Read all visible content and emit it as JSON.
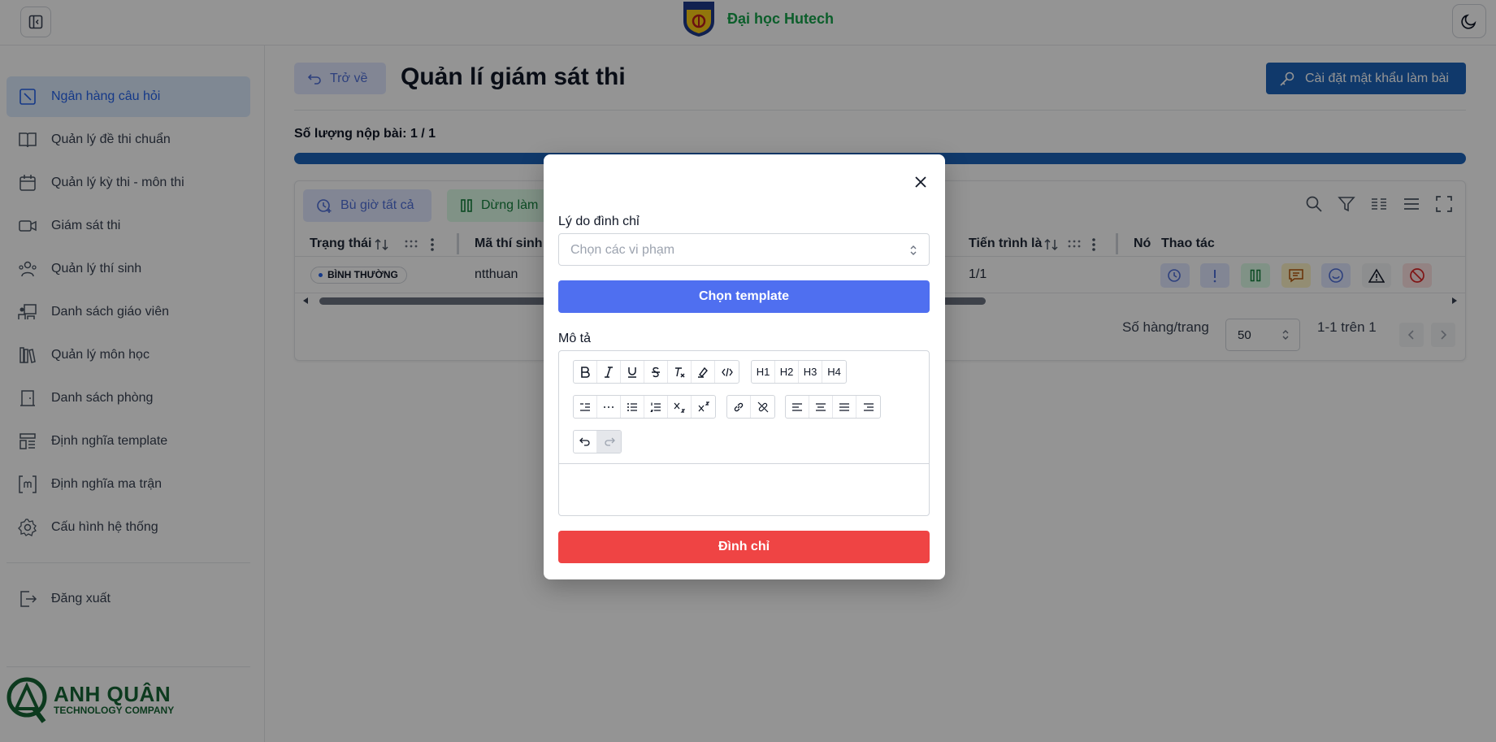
{
  "header": {
    "brand_name": "Đại học Hutech",
    "logo_caption": "HUTECH"
  },
  "sidebar": {
    "items": [
      {
        "label": "Ngân hàng câu hỏi",
        "icon": "question-bank-icon",
        "active": true
      },
      {
        "label": "Quản lý đề thi chuẩn",
        "icon": "book-open-icon"
      },
      {
        "label": "Quản lý kỳ thi - môn thi",
        "icon": "calendar-icon"
      },
      {
        "label": "Giám sát thi",
        "icon": "video-icon"
      },
      {
        "label": "Quản lý thí sinh",
        "icon": "users-icon"
      },
      {
        "label": "Danh sách giáo viên",
        "icon": "teacher-board-icon"
      },
      {
        "label": "Quản lý môn học",
        "icon": "books-icon"
      },
      {
        "label": "Danh sách phòng",
        "icon": "door-icon"
      },
      {
        "label": "Định nghĩa template",
        "icon": "template-icon"
      },
      {
        "label": "Định nghĩa ma trận",
        "icon": "matrix-brackets-icon"
      },
      {
        "label": "Cấu hình hệ thống",
        "icon": "gear-icon"
      }
    ],
    "logout_label": "Đăng xuất",
    "company_name": "ANH QUÂN",
    "company_sub": "TECHNOLOGY COMPANY"
  },
  "main": {
    "back_label": "Trở về",
    "title": "Quản lí giám sát thi",
    "password_button": "Cài đặt mật khẩu làm bài",
    "submission_count": "Số lượng nộp bài: 1 / 1",
    "progress": 1.0,
    "toolbar": {
      "extend_all": "Bù giờ tất cả",
      "stop": "Dừng làm"
    },
    "table": {
      "columns": [
        "Trạng thái",
        "Mã thí sinh",
        "Tiến trình là",
        "Nó",
        "Thao tác"
      ],
      "rows": [
        {
          "status": "BÌNH THƯỜNG",
          "candidate_id": "ntthuan",
          "progress": "1/1"
        }
      ]
    },
    "pagination": {
      "rows_label": "Số hàng/trang",
      "rows_value": "50",
      "range": "1-1 trên 1"
    }
  },
  "modal": {
    "reason_label": "Lý do đình chỉ",
    "reason_placeholder": "Chọn các vi phạm",
    "template_button": "Chọn template",
    "description_label": "Mô tả",
    "heading_buttons": [
      "H1",
      "H2",
      "H3",
      "H4"
    ],
    "submit_button": "Đình chỉ"
  },
  "colors": {
    "primary": "#1d63b8",
    "accent": "#4f6ff0",
    "danger": "#ef4444",
    "brand_green": "#16a34a"
  }
}
